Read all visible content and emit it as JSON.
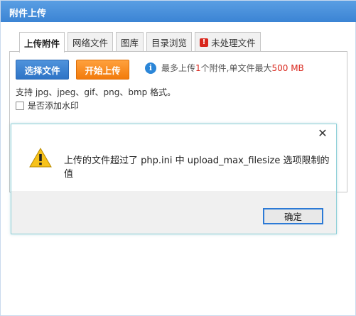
{
  "window": {
    "title": "附件上传"
  },
  "tabs": [
    {
      "label": "上传附件",
      "active": true
    },
    {
      "label": "网络文件"
    },
    {
      "label": "图库"
    },
    {
      "label": "目录浏览"
    },
    {
      "label": "未处理文件",
      "icon": "warning-icon"
    }
  ],
  "toolbar": {
    "select_label": "选择文件",
    "start_label": "开始上传",
    "info_prefix": "最多上传 ",
    "info_count": "1",
    "info_middle": " 个附件,单文件最大 ",
    "info_max": "500 MB"
  },
  "formats_text": "支持 jpg、jpeg、gif、png、bmp 格式。",
  "watermark_label": "是否添加水印",
  "dialog": {
    "message": "上传的文件超过了 php.ini 中 upload_max_filesize 选项限制的值",
    "ok_label": "确定",
    "close_glyph": "✕"
  },
  "colors": {
    "title_bar": "#3b84d4",
    "select_button": "#2e74c6",
    "start_button": "#f27b0c",
    "highlight": "#d9271d"
  }
}
